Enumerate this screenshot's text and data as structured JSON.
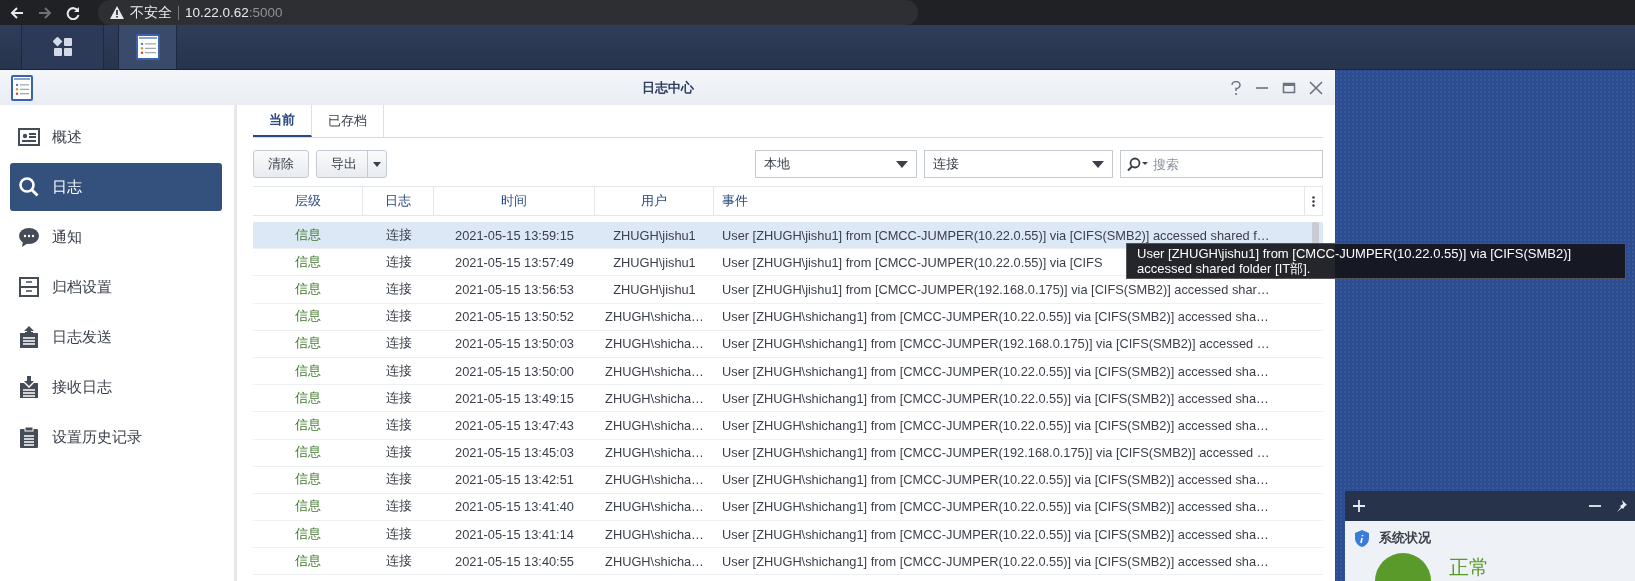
{
  "browser": {
    "security_label": "不安全",
    "host": "10.22.0.62",
    "port": ":5000",
    "forward_disabled": true
  },
  "taskbar": {
    "items": [
      {
        "selected": false
      },
      {
        "selected": true
      }
    ]
  },
  "window": {
    "title": "日志中心"
  },
  "sidebar": {
    "items": [
      {
        "label": "概述",
        "selected": false
      },
      {
        "label": "日志",
        "selected": true
      },
      {
        "label": "通知",
        "selected": false
      },
      {
        "label": "归档设置",
        "selected": false
      },
      {
        "label": "日志发送",
        "selected": false
      },
      {
        "label": "接收日志",
        "selected": false
      },
      {
        "label": "设置历史记录",
        "selected": false
      }
    ]
  },
  "tabs": [
    {
      "label": "当前",
      "selected": true
    },
    {
      "label": "已存档",
      "selected": false
    }
  ],
  "toolbar": {
    "buttons": [
      {
        "label": "清除",
        "kind": "plain"
      },
      {
        "label": "导出",
        "kind": "split"
      }
    ],
    "filters": [
      {
        "value": "本地"
      },
      {
        "value": "连接"
      }
    ],
    "search": {
      "placeholder": "搜索"
    }
  },
  "table": {
    "columns": [
      "层级",
      "日志",
      "时间",
      "用户",
      "事件"
    ],
    "rows": [
      {
        "level": "信息",
        "log": "连接",
        "time": "2021-05-15 13:59:15",
        "user": "ZHUGH\\jishu1",
        "event": "User [ZHUGH\\jishu1] from [CMCC-JUMPER(10.22.0.55)] via [CIFS(SMB2)] accessed shared f…",
        "selected": true
      },
      {
        "level": "信息",
        "log": "连接",
        "time": "2021-05-15 13:57:49",
        "user": "ZHUGH\\jishu1",
        "event": "User [ZHUGH\\jishu1] from [CMCC-JUMPER(10.22.0.55)] via [CIFS",
        "selected": false
      },
      {
        "level": "信息",
        "log": "连接",
        "time": "2021-05-15 13:56:53",
        "user": "ZHUGH\\jishu1",
        "event": "User [ZHUGH\\jishu1] from [CMCC-JUMPER(192.168.0.175)] via [CIFS(SMB2)] accessed shar…",
        "selected": false
      },
      {
        "level": "信息",
        "log": "连接",
        "time": "2021-05-15 13:50:52",
        "user": "ZHUGH\\shicha…",
        "event": "User [ZHUGH\\shichang1] from [CMCC-JUMPER(10.22.0.55)] via [CIFS(SMB2)] accessed sha…",
        "selected": false
      },
      {
        "level": "信息",
        "log": "连接",
        "time": "2021-05-15 13:50:03",
        "user": "ZHUGH\\shicha…",
        "event": "User [ZHUGH\\shichang1] from [CMCC-JUMPER(192.168.0.175)] via [CIFS(SMB2)] accessed …",
        "selected": false
      },
      {
        "level": "信息",
        "log": "连接",
        "time": "2021-05-15 13:50:00",
        "user": "ZHUGH\\shicha…",
        "event": "User [ZHUGH\\shichang1] from [CMCC-JUMPER(10.22.0.55)] via [CIFS(SMB2)] accessed sha…",
        "selected": false
      },
      {
        "level": "信息",
        "log": "连接",
        "time": "2021-05-15 13:49:15",
        "user": "ZHUGH\\shicha…",
        "event": "User [ZHUGH\\shichang1] from [CMCC-JUMPER(10.22.0.55)] via [CIFS(SMB2)] accessed sha…",
        "selected": false
      },
      {
        "level": "信息",
        "log": "连接",
        "time": "2021-05-15 13:47:43",
        "user": "ZHUGH\\shicha…",
        "event": "User [ZHUGH\\shichang1] from [CMCC-JUMPER(10.22.0.55)] via [CIFS(SMB2)] accessed sha…",
        "selected": false
      },
      {
        "level": "信息",
        "log": "连接",
        "time": "2021-05-15 13:45:03",
        "user": "ZHUGH\\shicha…",
        "event": "User [ZHUGH\\shichang1] from [CMCC-JUMPER(192.168.0.175)] via [CIFS(SMB2)] accessed …",
        "selected": false
      },
      {
        "level": "信息",
        "log": "连接",
        "time": "2021-05-15 13:42:51",
        "user": "ZHUGH\\shicha…",
        "event": "User [ZHUGH\\shichang1] from [CMCC-JUMPER(10.22.0.55)] via [CIFS(SMB2)] accessed sha…",
        "selected": false
      },
      {
        "level": "信息",
        "log": "连接",
        "time": "2021-05-15 13:41:40",
        "user": "ZHUGH\\shicha…",
        "event": "User [ZHUGH\\shichang1] from [CMCC-JUMPER(10.22.0.55)] via [CIFS(SMB2)] accessed sha…",
        "selected": false
      },
      {
        "level": "信息",
        "log": "连接",
        "time": "2021-05-15 13:41:14",
        "user": "ZHUGH\\shicha…",
        "event": "User [ZHUGH\\shichang1] from [CMCC-JUMPER(10.22.0.55)] via [CIFS(SMB2)] accessed sha…",
        "selected": false
      },
      {
        "level": "信息",
        "log": "连接",
        "time": "2021-05-15 13:40:55",
        "user": "ZHUGH\\shicha…",
        "event": "User [ZHUGH\\shichang1] from [CMCC-JUMPER(10.22.0.55)] via [CIFS(SMB2)] accessed sha…",
        "selected": false
      }
    ]
  },
  "tooltip": {
    "text": "User [ZHUGH\\jishu1] from [CMCC-JUMPER(10.22.0.55)] via [CIFS(SMB2)] accessed shared folder [IT部]."
  },
  "widget": {
    "title": "系统状况",
    "status": "正常"
  }
}
